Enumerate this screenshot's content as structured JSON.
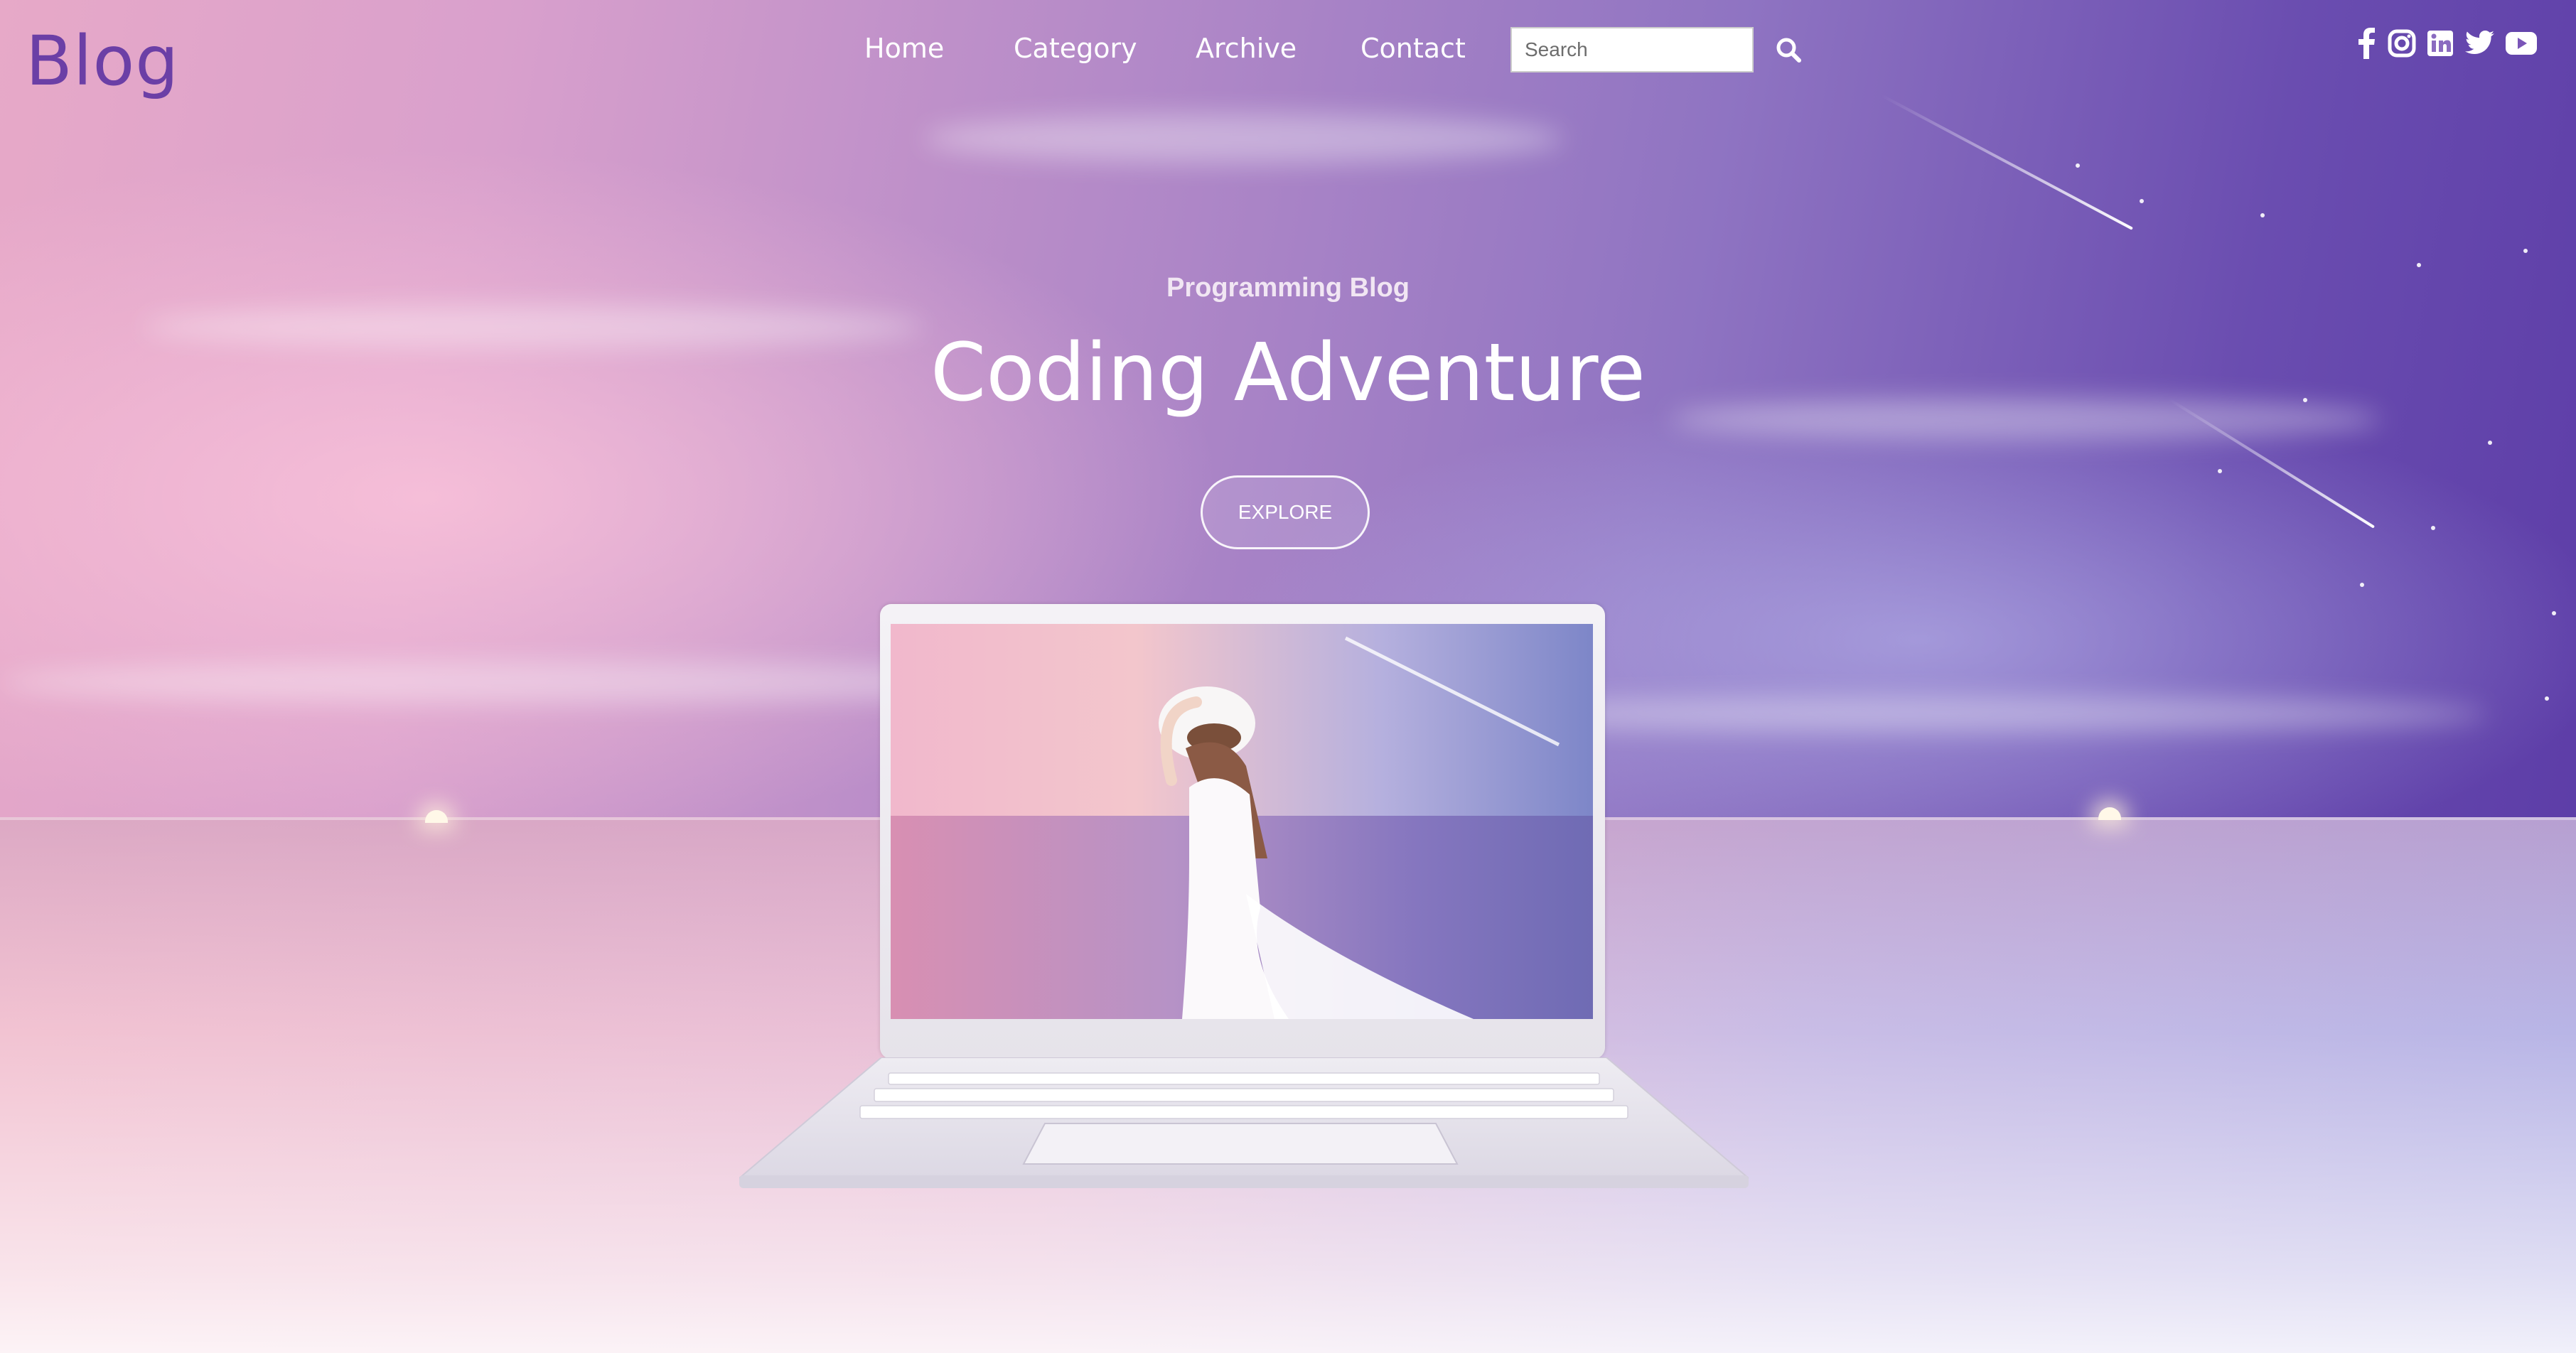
{
  "brand": {
    "logo": "Blog",
    "logo_color": "#6b3fa6"
  },
  "nav": {
    "items": [
      {
        "label": "Home"
      },
      {
        "label": "Category"
      },
      {
        "label": "Archive"
      },
      {
        "label": "Contact"
      }
    ]
  },
  "search": {
    "placeholder": "Search",
    "icon": "search-icon"
  },
  "social": [
    "facebook-icon",
    "instagram-icon",
    "linkedin-icon",
    "twitter-icon",
    "youtube-icon"
  ],
  "hero": {
    "kicker": "Programming Blog",
    "title": "Coding Adventure",
    "cta": "EXPLORE"
  },
  "colors": {
    "accent": "#6b3fa6",
    "text_light": "#ffffff"
  }
}
